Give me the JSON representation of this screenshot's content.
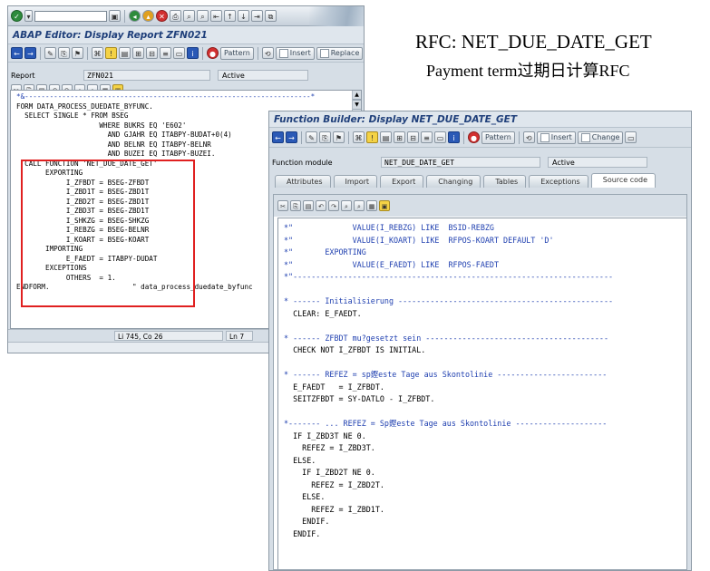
{
  "heading": {
    "line1": "RFC: NET_DUE_DATE_GET",
    "line2": "Payment term过期日计算RFC"
  },
  "editor_window": {
    "title": "ABAP Editor: Display Report ZFN021",
    "buttons": {
      "pattern": "Pattern",
      "insert": "Insert",
      "replace": "Replace"
    },
    "report_label": "Report",
    "report_value": "ZFN021",
    "status": "Active",
    "code": [
      "*&---------------------------------------------------------------------*",
      "FORM DATA_PROCESS_DUEDATE_BYFUNC.",
      "  SELECT SINGLE * FROM BSEG",
      "                    WHERE BUKRS EQ 'E602'",
      "                      AND GJAHR EQ ITABPY-BUDAT+0(4)",
      "                      AND BELNR EQ ITABPY-BELNR",
      "                      AND BUZEI EQ ITABPY-BUZEI.",
      "  CALL FUNCTION 'NET_DUE_DATE_GET'",
      "       EXPORTING",
      "            I_ZFBDT = BSEG-ZFBDT",
      "            I_ZBD1T = BSEG-ZBD1T",
      "            I_ZBD2T = BSEG-ZBD1T",
      "            I_ZBD3T = BSEG-ZBD1T",
      "            I_SHKZG = BSEG-SHKZG",
      "            I_REBZG = BSEG-BELNR",
      "            I_KOART = BSEG-KOART",
      "       IMPORTING",
      "            E_FAEDT = ITABPY-DUDAT",
      "       EXCEPTIONS",
      "            OTHERS  = 1.",
      "ENDFORM.                    \" data_process_duedate_byfunc"
    ],
    "cursor_position": "Li 745, Co 26",
    "line_indicator": "Ln 7"
  },
  "fb_window": {
    "title": "Function Builder: Display NET_DUE_DATE_GET",
    "buttons": {
      "pattern": "Pattern",
      "insert": "Insert",
      "change": "Change"
    },
    "fm_label": "Function module",
    "fm_value": "NET_DUE_DATE_GET",
    "status": "Active",
    "tabs": [
      "Attributes",
      "Import",
      "Export",
      "Changing",
      "Tables",
      "Exceptions",
      "Source code"
    ],
    "active_tab": "Source code",
    "code": [
      {
        "text": "*\"             VALUE(I_REBZG) LIKE  BSID-REBZG",
        "comment": true
      },
      {
        "text": "*\"             VALUE(I_KOART) LIKE  RFPOS-KOART DEFAULT 'D'",
        "comment": true
      },
      {
        "text": "*\"       EXPORTING",
        "comment": true
      },
      {
        "text": "*\"             VALUE(E_FAEDT) LIKE  RFPOS-FAEDT",
        "comment": true
      },
      {
        "text": "*\"----------------------------------------------------------------------",
        "comment": true
      },
      {
        "text": "",
        "comment": false
      },
      {
        "text": "* ------ Initialisierung -----------------------------------------------",
        "comment": true
      },
      {
        "text": "  CLEAR: E_FAEDT.",
        "comment": false
      },
      {
        "text": "",
        "comment": false
      },
      {
        "text": "* ------ ZFBDT mu?gesetzt sein ----------------------------------------",
        "comment": true
      },
      {
        "text": "  CHECK NOT I_ZFBDT IS INITIAL.",
        "comment": false
      },
      {
        "text": "",
        "comment": false
      },
      {
        "text": "* ------ REFEZ = sp鏗este Tage aus Skontolinie ------------------------",
        "comment": true
      },
      {
        "text": "  E_FAEDT   = I_ZFBDT.",
        "comment": false
      },
      {
        "text": "  SEITZFBDT = SY-DATLO - I_ZFBDT.",
        "comment": false
      },
      {
        "text": "",
        "comment": false
      },
      {
        "text": "*------- ... REFEZ = Sp鏗este Tage aus Skontolinie --------------------",
        "comment": true
      },
      {
        "text": "  IF I_ZBD3T NE 0.",
        "comment": false
      },
      {
        "text": "    REFEZ = I_ZBD3T.",
        "comment": false
      },
      {
        "text": "  ELSE.",
        "comment": false
      },
      {
        "text": "    IF I_ZBD2T NE 0.",
        "comment": false
      },
      {
        "text": "      REFEZ = I_ZBD2T.",
        "comment": false
      },
      {
        "text": "    ELSE.",
        "comment": false
      },
      {
        "text": "      REFEZ = I_ZBD1T.",
        "comment": false
      },
      {
        "text": "    ENDIF.",
        "comment": false
      },
      {
        "text": "  ENDIF.",
        "comment": false
      }
    ]
  },
  "colors": {
    "highlight_box": "#e02020",
    "comment_text": "#2040b0",
    "title_text": "#1f3f7a"
  }
}
